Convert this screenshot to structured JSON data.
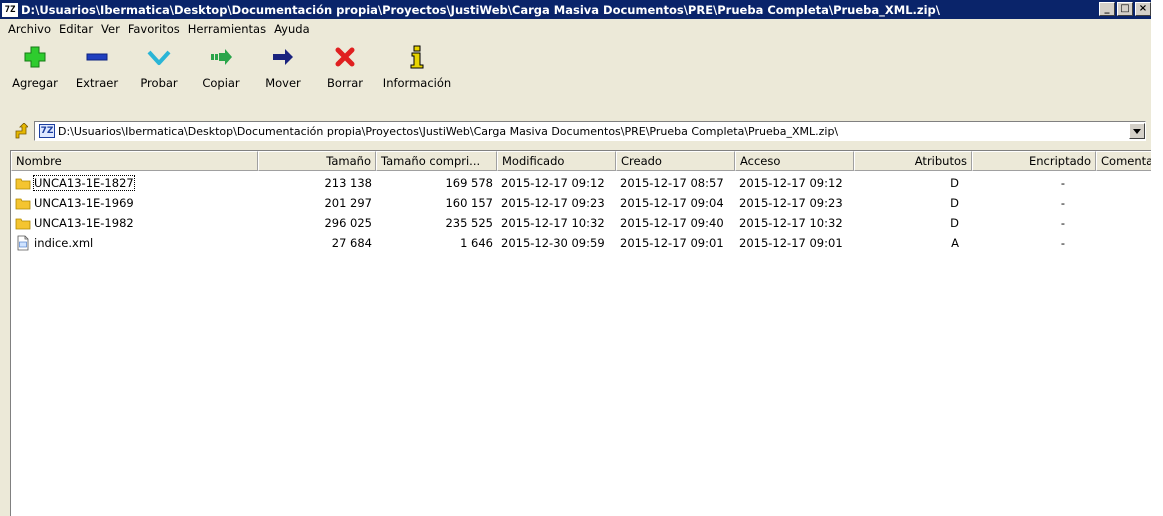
{
  "window": {
    "title": "D:\\Usuarios\\Ibermatica\\Desktop\\Documentación propia\\Proyectos\\JustiWeb\\Carga Masiva Documentos\\PRE\\Prueba Completa\\Prueba_XML.zip\\",
    "app_badge": "7Z",
    "controls": {
      "minimize": "_",
      "maximize": "□",
      "close": "×"
    }
  },
  "menu": [
    "Archivo",
    "Editar",
    "Ver",
    "Favoritos",
    "Herramientas",
    "Ayuda"
  ],
  "toolbar": [
    {
      "label": "Agregar",
      "icon": "add-icon",
      "color": "#2ecc2e"
    },
    {
      "label": "Extraer",
      "icon": "extract-icon",
      "color": "#1f3fbf"
    },
    {
      "label": "Probar",
      "icon": "test-icon",
      "color": "#2ab5d6"
    },
    {
      "label": "Copiar",
      "icon": "copy-icon",
      "color": "#2aa54a"
    },
    {
      "label": "Mover",
      "icon": "move-icon",
      "color": "#1a237e"
    },
    {
      "label": "Borrar",
      "icon": "delete-icon",
      "color": "#e02020"
    },
    {
      "label": "Información",
      "icon": "info-icon",
      "color": "#e8d400"
    }
  ],
  "address": {
    "path": "D:\\Usuarios\\Ibermatica\\Desktop\\Documentación propia\\Proyectos\\JustiWeb\\Carga Masiva Documentos\\PRE\\Prueba Completa\\Prueba_XML.zip\\",
    "badge": "7Z"
  },
  "columns": [
    "Nombre",
    "Tamaño",
    "Tamaño compri...",
    "Modificado",
    "Creado",
    "Acceso",
    "Atributos",
    "Encriptado",
    "Comentario"
  ],
  "files": [
    {
      "name": "UNCA13-1E-1827",
      "type": "folder",
      "size": "213 138",
      "packed": "169 578",
      "modified": "2015-12-17 09:12",
      "created": "2015-12-17 08:57",
      "accessed": "2015-12-17 09:12",
      "attributes": "D",
      "encrypted": "-",
      "comment": ""
    },
    {
      "name": "UNCA13-1E-1969",
      "type": "folder",
      "size": "201 297",
      "packed": "160 157",
      "modified": "2015-12-17 09:23",
      "created": "2015-12-17 09:04",
      "accessed": "2015-12-17 09:23",
      "attributes": "D",
      "encrypted": "-",
      "comment": ""
    },
    {
      "name": "UNCA13-1E-1982",
      "type": "folder",
      "size": "296 025",
      "packed": "235 525",
      "modified": "2015-12-17 10:32",
      "created": "2015-12-17 09:40",
      "accessed": "2015-12-17 10:32",
      "attributes": "D",
      "encrypted": "-",
      "comment": ""
    },
    {
      "name": "indice.xml",
      "type": "xml",
      "size": "27 684",
      "packed": "1 646",
      "modified": "2015-12-30 09:59",
      "created": "2015-12-17 09:01",
      "accessed": "2015-12-17 09:01",
      "attributes": "A",
      "encrypted": "-",
      "comment": ""
    }
  ]
}
